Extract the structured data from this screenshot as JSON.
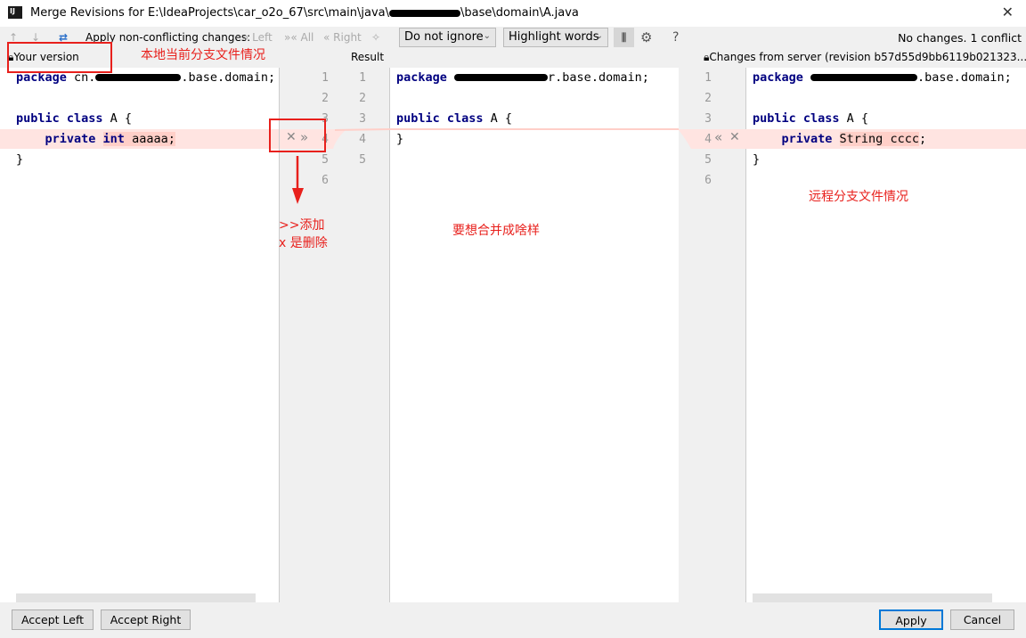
{
  "window": {
    "title_prefix": "Merge Revisions for E:\\IdeaProjects\\car_o2o_67\\src\\main\\java\\",
    "title_suffix": "\\base\\domain\\A.java",
    "app_icon": "IJ",
    "close": "✕"
  },
  "toolbar": {
    "apply_label": "Apply non-conflicting changes:",
    "left": "Left",
    "all": "All",
    "right": "Right",
    "ignore_select": "Do not ignore",
    "highlight_select": "Highlight words",
    "help": "?",
    "status": "No changes. 1 conflict"
  },
  "headers": {
    "left": "Your version",
    "middle": "Result",
    "right": "Changes from server (revision b57d55d9bb6119b021323..."
  },
  "left_code": {
    "l1a": "package",
    "l1b": " cn.",
    "l1c": ".base.domain;",
    "l3a": "public class",
    "l3b": " A {",
    "l4a": "    private ",
    "l4b": "int",
    "l4c": " aaaaa;",
    "l5": "}"
  },
  "middle_code": {
    "l1a": "package",
    "l1c": "r.base.domain;",
    "l3a": "public class",
    "l3b": " A {",
    "l4": "}"
  },
  "right_code": {
    "l1a": "package",
    "l1c": ".base.domain;",
    "l3a": "public class",
    "l3b": " A {",
    "l4a": "    private ",
    "l4b": "String cccc",
    ";": ";",
    "l5": "}"
  },
  "gutter": {
    "left_numbers": [
      "1",
      "2",
      "3",
      "4",
      "5",
      "6"
    ],
    "mid_numbers": [
      "1",
      "2",
      "3",
      "4",
      "5"
    ],
    "right_numbers": [
      "1",
      "2",
      "3",
      "4",
      "5",
      "6"
    ]
  },
  "annotations": {
    "local": "本地当前分支文件情况",
    "add": ">>添加",
    "delete": "x 是删除",
    "result": "要想合并成啥样",
    "remote": "远程分支文件情况"
  },
  "buttons": {
    "accept_left": "Accept Left",
    "accept_right": "Accept Right",
    "apply": "Apply",
    "cancel": "Cancel"
  },
  "colors": {
    "conflict": "#ffe4e1",
    "annotation": "#e8201c",
    "keyword": "#000080"
  }
}
